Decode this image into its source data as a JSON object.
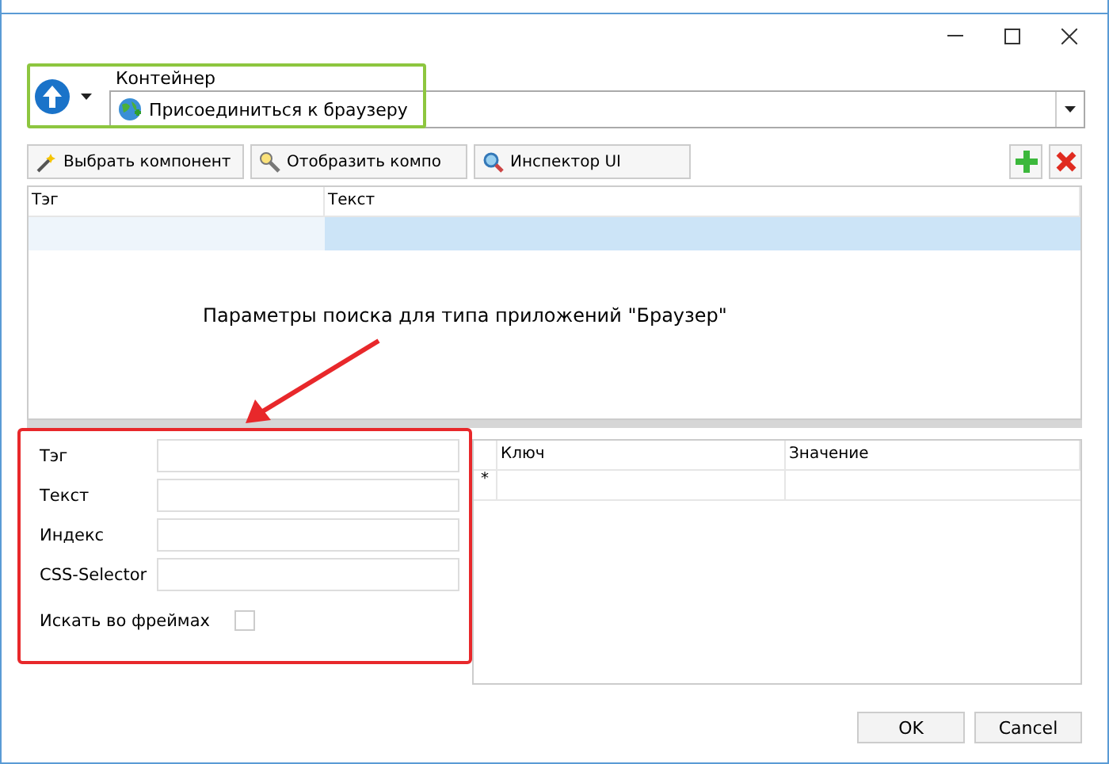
{
  "container": {
    "label": "Контейнер",
    "value": "Присоединиться к браузеру",
    "highlighted": true
  },
  "toolbar": [
    {
      "kind": "pick",
      "label": "Выбрать компонент"
    },
    {
      "kind": "show",
      "label": "Отобразить компо"
    },
    {
      "kind": "inspect",
      "label": "Инспектор UI"
    }
  ],
  "table": {
    "columns": [
      "Тэг",
      "Текст"
    ]
  },
  "annotation": "Параметры поиска для типа приложений \"Браузер\"",
  "search_form": {
    "highlighted": true,
    "fields": [
      {
        "kind": "text",
        "label": "Тэг"
      },
      {
        "kind": "text",
        "label": "Текст"
      },
      {
        "kind": "text",
        "label": "Индекс"
      },
      {
        "kind": "text",
        "label": "CSS-Selector"
      },
      {
        "kind": "checkbox",
        "label": "Искать во фреймах",
        "checked": false
      }
    ]
  },
  "params_grid": {
    "columns": [
      "Ключ",
      "Значение"
    ],
    "new_row_marker": "*"
  },
  "buttons": [
    "OK",
    "Cancel"
  ]
}
